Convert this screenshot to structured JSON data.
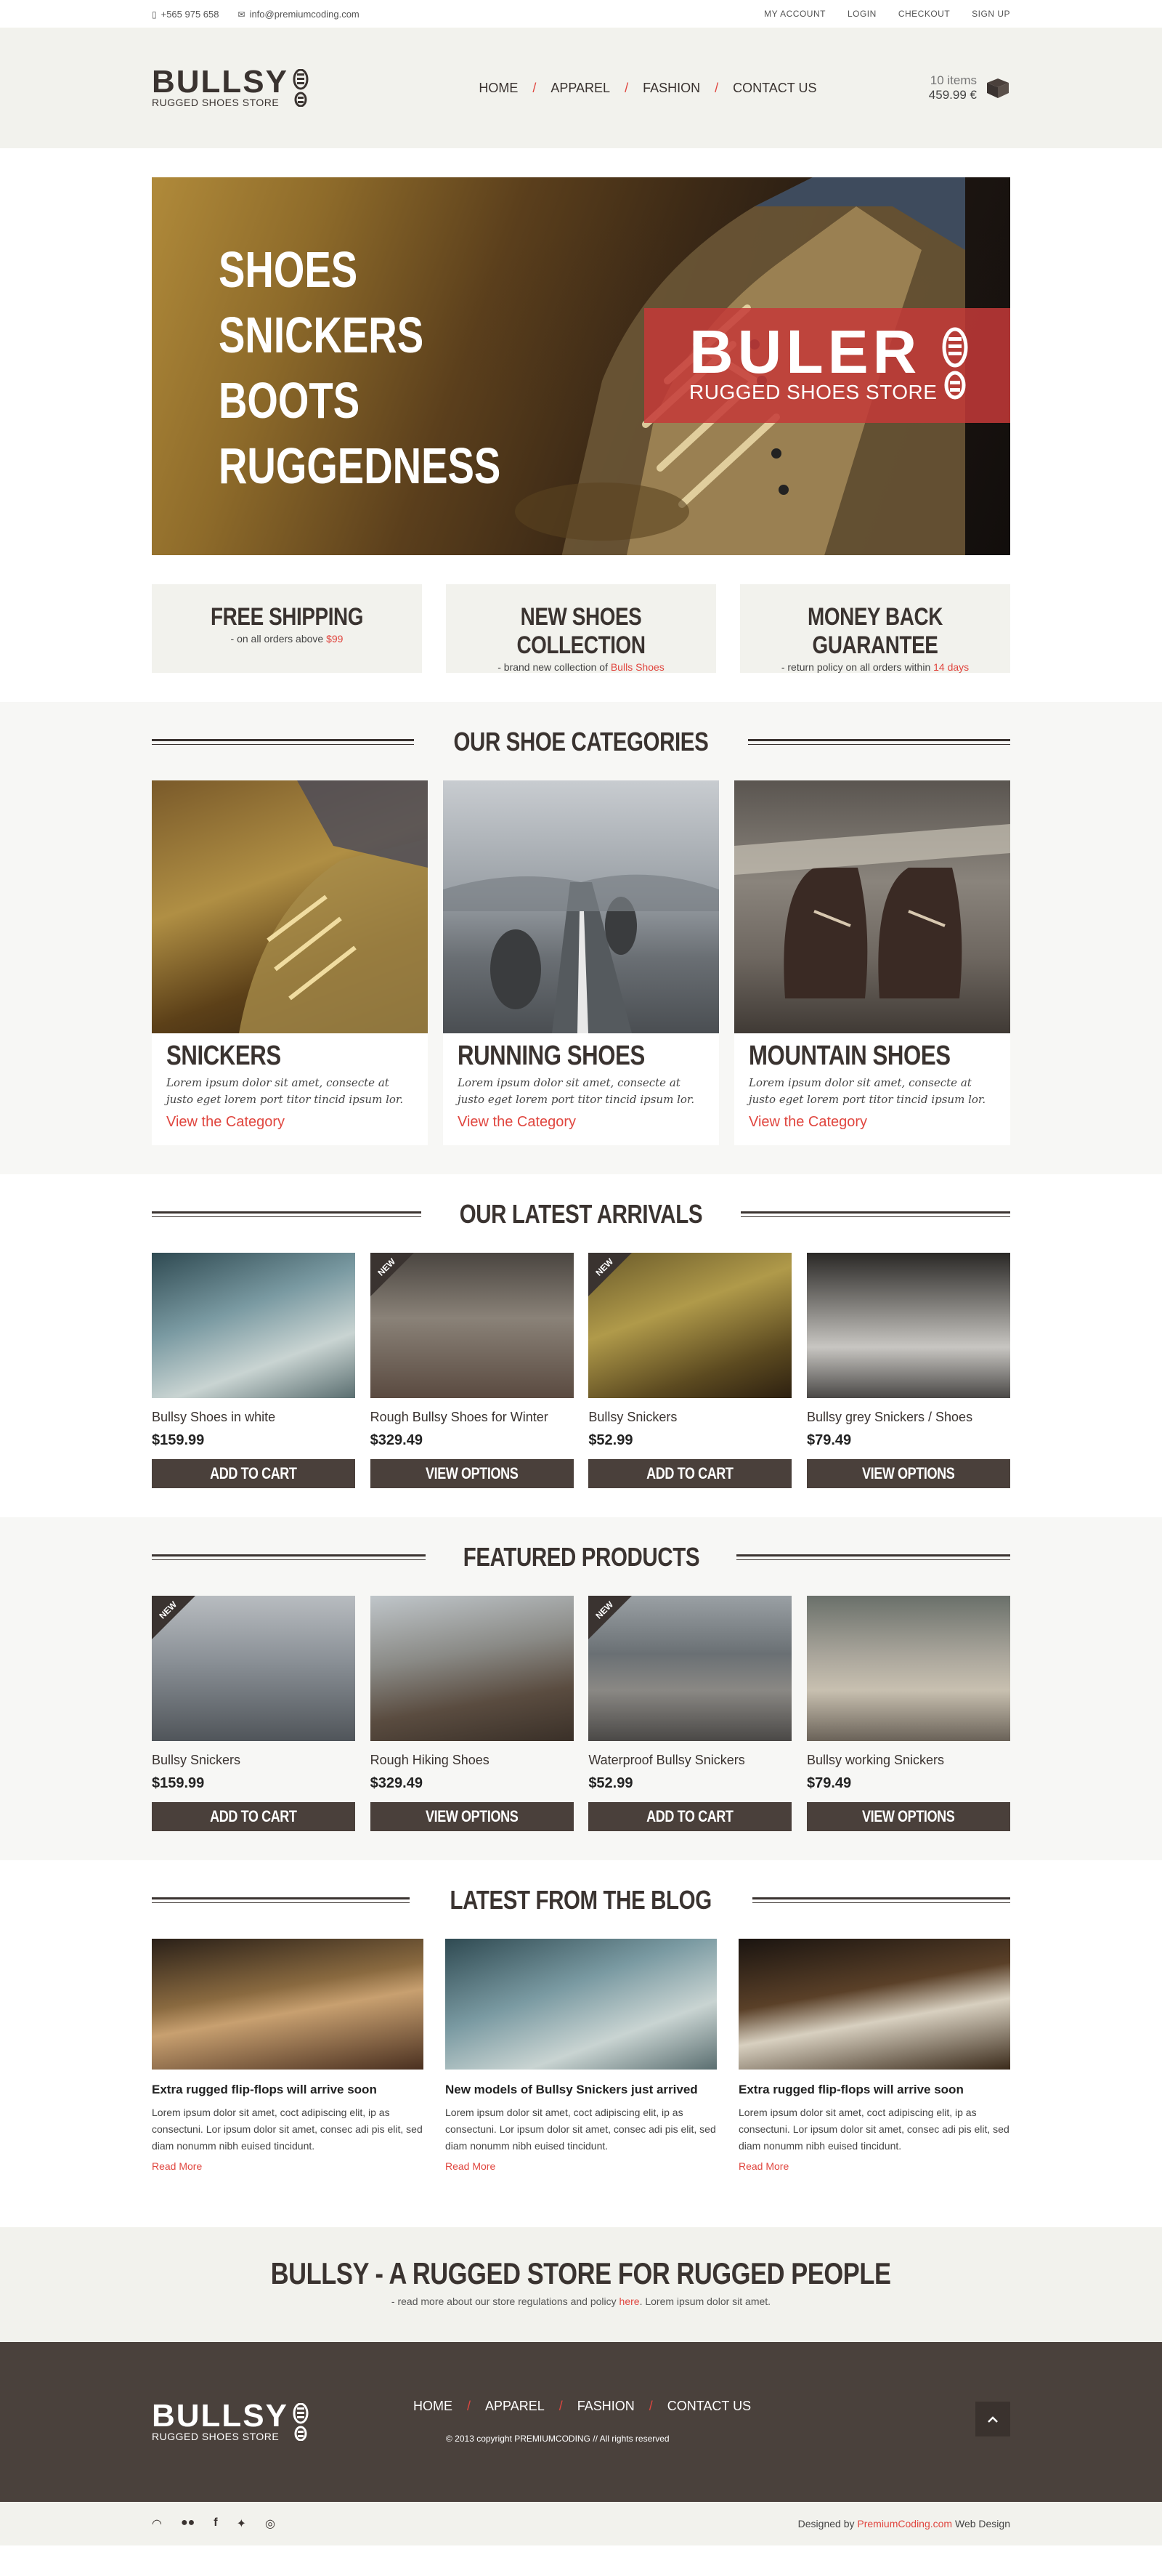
{
  "topbar": {
    "phone": "+565 975 658",
    "email": "info@premiumcoding.com",
    "links": [
      "MY ACCOUNT",
      "LOGIN",
      "CHECKOUT",
      "SIGN UP"
    ]
  },
  "header": {
    "logo_name": "BULLSY",
    "logo_tag": "RUGGED SHOES STORE",
    "nav": [
      "HOME",
      "APPAREL",
      "FASHION",
      "CONTACT US"
    ],
    "nav_sep": "/",
    "cart_items": "10 items",
    "cart_total": "459.99 €"
  },
  "hero": {
    "words": [
      "SHOES",
      "SNICKERS",
      "BOOTS",
      "RUGGEDNESS"
    ],
    "banner_name": "BULER",
    "banner_tag": "RUGGED SHOES STORE"
  },
  "features": [
    {
      "title": "FREE SHIPPING",
      "desc": "- on all orders above ",
      "highlight": "$99"
    },
    {
      "title": "NEW SHOES COLLECTION",
      "desc": "- brand new collection of ",
      "highlight": "Bulls Shoes"
    },
    {
      "title": "MONEY BACK GUARANTEE",
      "desc": "- return policy on all orders within ",
      "highlight": "14 days"
    }
  ],
  "categories": {
    "title": "OUR SHOE CATEGORIES",
    "items": [
      {
        "title": "SNICKERS",
        "desc": "Lorem ipsum dolor sit amet, consecte at justo eget lorem port titor tincid ipsum lor.",
        "link": "View the Category"
      },
      {
        "title": "RUNNING SHOES",
        "desc": "Lorem ipsum dolor sit amet, consecte at justo eget lorem port titor tincid ipsum lor.",
        "link": "View the Category"
      },
      {
        "title": "MOUNTAIN SHOES",
        "desc": "Lorem ipsum dolor sit amet, consecte at justo eget lorem port titor tincid ipsum lor.",
        "link": "View the Category"
      }
    ]
  },
  "latest": {
    "title": "OUR LATEST ARRIVALS",
    "items": [
      {
        "name": "Bullsy Shoes in white",
        "price": "$159.99",
        "button": "ADD TO CART",
        "new": ""
      },
      {
        "name": "Rough Bullsy Shoes for Winter",
        "price": "$329.49",
        "button": "VIEW OPTIONS",
        "new": "NEW"
      },
      {
        "name": "Bullsy Snickers",
        "price": "$52.99",
        "button": "ADD TO CART",
        "new": "NEW"
      },
      {
        "name": "Bullsy grey Snickers / Shoes",
        "price": "$79.49",
        "button": "VIEW OPTIONS",
        "new": ""
      }
    ]
  },
  "featured": {
    "title": "FEATURED PRODUCTS",
    "items": [
      {
        "name": "Bullsy Snickers",
        "price": "$159.99",
        "button": "ADD TO CART",
        "new": "NEW"
      },
      {
        "name": "Rough Hiking Shoes",
        "price": "$329.49",
        "button": "VIEW OPTIONS",
        "new": ""
      },
      {
        "name": "Waterproof Bullsy Snickers",
        "price": "$52.99",
        "button": "ADD TO CART",
        "new": "NEW"
      },
      {
        "name": "Bullsy working Snickers",
        "price": "$79.49",
        "button": "VIEW OPTIONS",
        "new": ""
      }
    ]
  },
  "blog": {
    "title": "LATEST FROM THE BLOG",
    "items": [
      {
        "title": "Extra rugged flip-flops will arrive soon",
        "desc": "Lorem ipsum dolor sit amet, coct adipiscing elit, ip as consectuni. Lor ipsum dolor sit amet, consec adi pis elit, sed diam nonumm nibh euised tincidunt.",
        "more": "Read More"
      },
      {
        "title": "New models of Bullsy Snickers just arrived",
        "desc": "Lorem ipsum dolor sit amet, coct adipiscing elit, ip as consectuni. Lor ipsum dolor sit amet, consec adi pis elit, sed diam nonumm nibh euised tincidunt.",
        "more": "Read More"
      },
      {
        "title": "Extra rugged flip-flops will arrive soon",
        "desc": "Lorem ipsum dolor sit amet, coct adipiscing elit, ip as consectuni. Lor ipsum dolor sit amet, consec adi pis elit, sed diam nonumm nibh euised tincidunt.",
        "more": "Read More"
      }
    ]
  },
  "tagline": {
    "title": "BULLSY - A RUGGED STORE FOR RUGGED PEOPLE",
    "desc_before": "- read more about our store regulations and policy ",
    "desc_link": "here",
    "desc_after": ". Lorem ipsum dolor sit amet."
  },
  "footer": {
    "logo_name": "BULLSY",
    "logo_tag": "RUGGED SHOES STORE",
    "nav": [
      "HOME",
      "APPAREL",
      "FASHION",
      "CONTACT US"
    ],
    "copyright": "© 2013 copyright PREMIUMCODING // All rights reserved",
    "up_icon": "chevron-up-icon"
  },
  "bottombar": {
    "social": [
      "rss-icon",
      "flickr-icon",
      "facebook-icon",
      "twitter-icon",
      "dribbble-icon"
    ],
    "credit_before": "Designed by ",
    "credit_link": "PremiumCoding.com",
    "credit_after": " Web Design"
  },
  "colors": {
    "accent": "#e0463f",
    "dark": "#3a3330",
    "button": "#4a403b",
    "panel": "#f2f2ed",
    "footer": "#4a413c"
  }
}
